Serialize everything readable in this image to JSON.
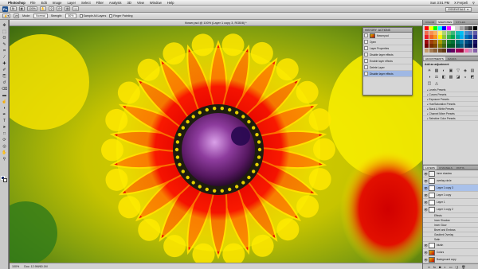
{
  "menubar": {
    "app": "Photoshop",
    "items": [
      "File",
      "Edit",
      "Image",
      "Layer",
      "Select",
      "Filter",
      "Analysis",
      "3D",
      "View",
      "Window",
      "Help"
    ],
    "clock": "Sun 3:01 PM",
    "user": "X Ferpeli"
  },
  "appbar": {
    "logo": "Ps",
    "zoom": "100%",
    "workspace": "ESSENTIALS"
  },
  "options": {
    "mode_label": "Mode:",
    "mode_value": "Normal",
    "strength_label": "Strength:",
    "strength_value": "50%",
    "sample_all_layers": "Sample All Layers",
    "finger_painting": "Finger Painting"
  },
  "document": {
    "title": "flower.psd @ 100% (Layer 1 copy 3, RGB/8) *",
    "zoom": "100%",
    "doc_size": "Doc: 12.9M/60.1M"
  },
  "history": {
    "tabs": [
      "HISTORY",
      "ACTIONS"
    ],
    "snapshot": "flower.psd",
    "items": [
      "Open",
      "Layer Properties",
      "Disable layer effects",
      "Enable layer effects",
      "Delete Layer",
      "Disable layer effects"
    ]
  },
  "swatches": {
    "tabs": [
      "COLOR",
      "SWATCHES",
      "STYLES"
    ],
    "colors": [
      "#ff0000",
      "#ffff00",
      "#00ff00",
      "#00ffff",
      "#0000ff",
      "#ff00ff",
      "#ffffff",
      "#d0d0d0",
      "#a0a0a0",
      "#707070",
      "#404040",
      "#000000",
      "#f26c4f",
      "#f68e56",
      "#fbaf5c",
      "#fff467",
      "#acd372",
      "#7cc576",
      "#3bb878",
      "#1abbb4",
      "#00bff3",
      "#438ccb",
      "#5574b9",
      "#605ca8",
      "#ed1c24",
      "#f26522",
      "#f7941d",
      "#fff200",
      "#8dc63f",
      "#39b54a",
      "#00a651",
      "#00a99d",
      "#00aeef",
      "#0072bc",
      "#0054a6",
      "#2e3192",
      "#9e0b0f",
      "#a0410d",
      "#a36209",
      "#aba000",
      "#598527",
      "#1a7b30",
      "#007236",
      "#00746b",
      "#0076a3",
      "#004b80",
      "#003471",
      "#1b1464",
      "#790000",
      "#7b2e00",
      "#7d4900",
      "#827b00",
      "#406618",
      "#005e20",
      "#005826",
      "#005952",
      "#005b7f",
      "#003663",
      "#002157",
      "#0d004c",
      "#c69c6d",
      "#a67c52",
      "#8c6239",
      "#754c24",
      "#603913",
      "#440e62",
      "#630460",
      "#9e005d",
      "#9e0039",
      "#f06eaa",
      "#bd8cbf",
      "#8560a8"
    ]
  },
  "adjustments": {
    "tabs": [
      "ADJUSTMENTS",
      "MASKS"
    ],
    "title": "Add an adjustment",
    "icons": [
      "☀",
      "▦",
      "◐",
      "▣",
      "▽",
      "◈",
      "▤",
      "◑",
      "⚖",
      "◧",
      "▩",
      "◪",
      "◒",
      "◩",
      "◫",
      "◬"
    ],
    "presets": [
      "Levels Presets",
      "Curves Presets",
      "Exposure Presets",
      "Hue/Saturation Presets",
      "Black & White Presets",
      "Channel Mixer Presets",
      "Selective Color Presets"
    ]
  },
  "layers": {
    "tabs": [
      "LAYERS",
      "CHANNELS",
      "PATHS"
    ],
    "rows": [
      {
        "name": "inner shadow",
        "kind": "layer",
        "visible": true,
        "selected": false
      },
      {
        "name": "overlay circle",
        "kind": "group",
        "visible": true,
        "selected": false
      },
      {
        "name": "Layer 1 copy 3",
        "kind": "layer",
        "visible": true,
        "selected": true
      },
      {
        "name": "Layer 1 copy",
        "kind": "layer",
        "visible": true,
        "selected": false
      },
      {
        "name": "Layer 1",
        "kind": "layer",
        "visible": true,
        "selected": false
      },
      {
        "name": "Layer 1 copy 2",
        "kind": "layer",
        "visible": true,
        "selected": false
      }
    ],
    "effects": [
      "Effects",
      "Inner Shadow",
      "Inner Glow",
      "Bevel and Emboss",
      "Gradient Overlay",
      "Satin"
    ],
    "bottom_rows": [
      {
        "name": "bluish",
        "visible": true
      },
      {
        "name": "Colors",
        "visible": true
      },
      {
        "name": "Background copy",
        "visible": true
      },
      {
        "name": "Background",
        "visible": true
      }
    ]
  },
  "tools": [
    "move",
    "marquee",
    "lasso",
    "quick-select",
    "crop",
    "eyedropper",
    "healing",
    "brush",
    "clone-stamp",
    "history-brush",
    "eraser",
    "gradient",
    "smudge",
    "dodge",
    "pen",
    "type",
    "path-select",
    "shape",
    "3d-rotate",
    "3d-orbit",
    "hand",
    "zoom"
  ],
  "tool_glyphs": [
    "✥",
    "⬚",
    "ʘ",
    "✎",
    "⌗",
    "⁄",
    "✚",
    "✐",
    "⎘",
    "↺",
    "⌫",
    "▬",
    "☝",
    "◖",
    "✒",
    "T",
    "➤",
    "□",
    "⟳",
    "◎",
    "✋",
    "⚲"
  ]
}
